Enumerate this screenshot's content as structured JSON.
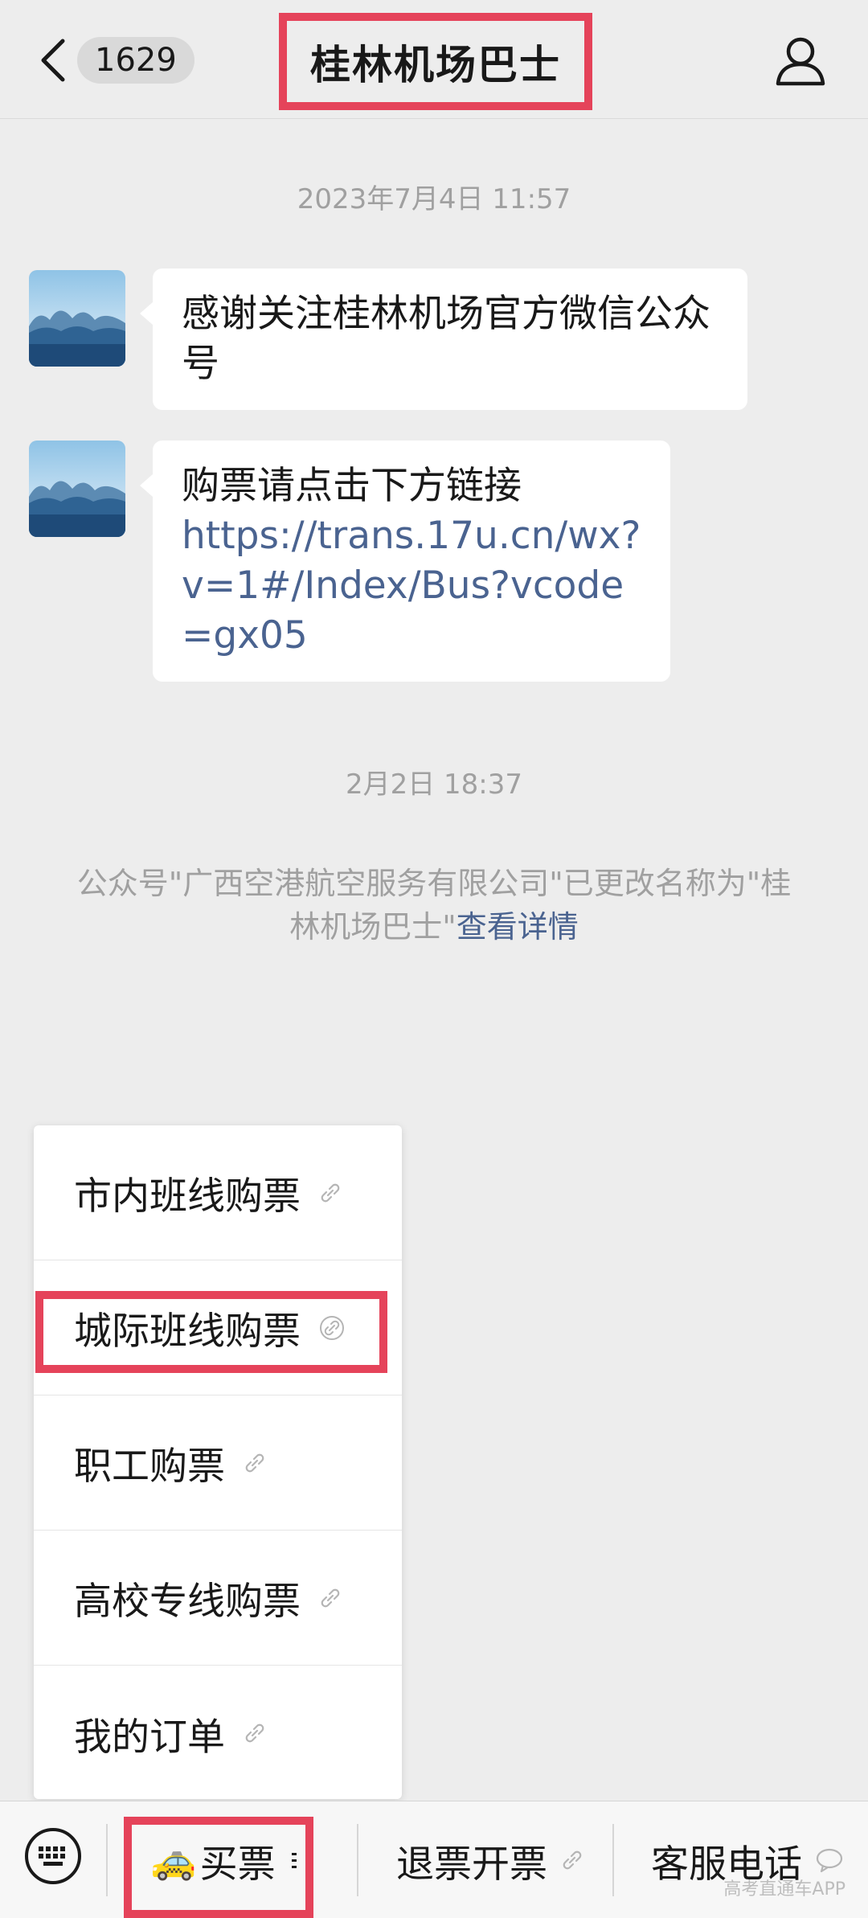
{
  "header": {
    "unread_count": "1629",
    "title": "桂林机场巴士"
  },
  "timestamps": {
    "first": "2023年7月4日 11:57",
    "second": "2月2日 18:37"
  },
  "messages": [
    {
      "text": "感谢关注桂林机场官方微信公众号"
    },
    {
      "text": "购票请点击下方链接",
      "link": "https://trans.17u.cn/wx?v=1#/Index/Bus?vcode=gx05"
    }
  ],
  "system_note": {
    "text": "公众号\"广西空港航空服务有限公司\"已更改名称为\"桂林机场巴士\"",
    "link": "查看详情"
  },
  "popup_menu": {
    "items": [
      "市内班线购票",
      "城际班线购票",
      "职工购票",
      "高校专线购票",
      "我的订单"
    ],
    "highlighted_index": 1
  },
  "bottom_menu": {
    "buy_label": "买票",
    "refund_label": "退票开票",
    "service_label": "客服电话"
  },
  "watermark": "高考直通车APP",
  "colors": {
    "highlight_border": "#e5435a",
    "link": "#4a6390",
    "background": "#ededed"
  }
}
